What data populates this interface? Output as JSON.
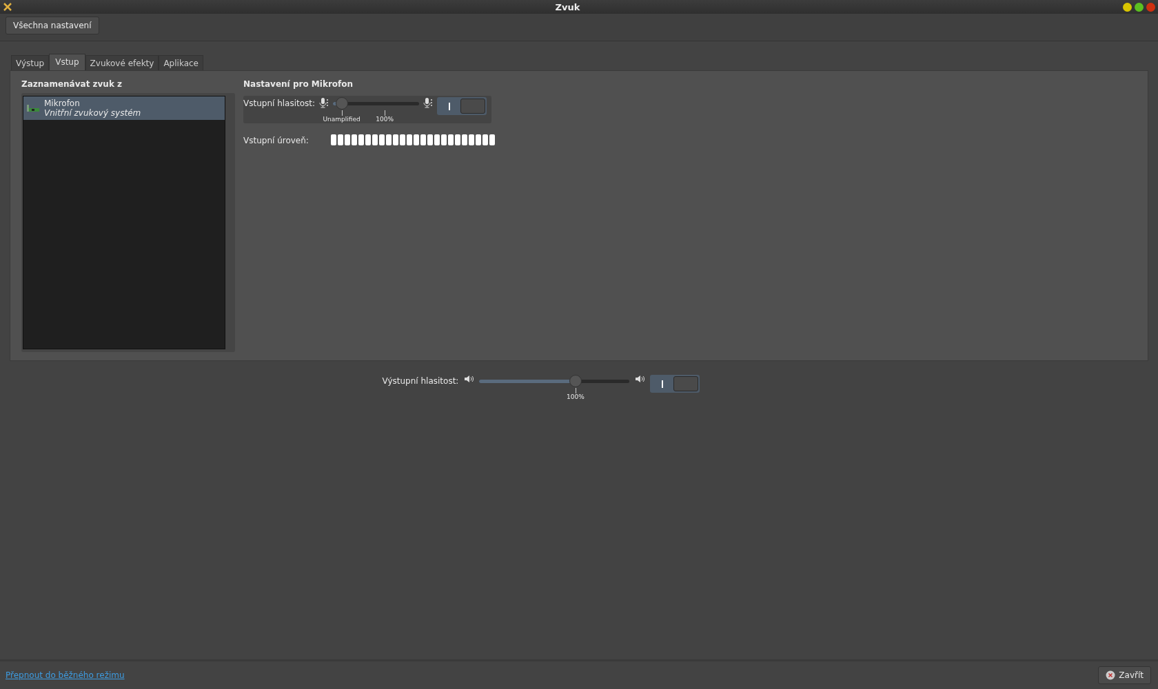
{
  "window": {
    "title": "Zvuk"
  },
  "toolbar": {
    "all_settings_button": "Všechna nastavení"
  },
  "tabs": [
    {
      "label": "Výstup",
      "selected": false
    },
    {
      "label": "Vstup",
      "selected": true
    },
    {
      "label": "Zvukové efekty",
      "selected": false
    },
    {
      "label": "Aplikace",
      "selected": false
    }
  ],
  "devices": {
    "heading": "Zaznamenávat zvuk z",
    "items": [
      {
        "name": "Mikrofon",
        "description": "Vnitřní zvukový systém",
        "selected": true
      }
    ]
  },
  "settings": {
    "heading": "Nastavení pro Mikrofon",
    "input_volume": {
      "label": "Vstupní hlasitost:",
      "level": 0.1,
      "marks": [
        {
          "label": "Unamplified"
        },
        {
          "label": "100%"
        }
      ],
      "on": true
    },
    "input_level": {
      "label": "Vstupní úroveň:"
    }
  },
  "output_volume": {
    "label": "Výstupní hlasitost:",
    "level": 0.64,
    "marks": [
      {
        "label": "100%"
      }
    ],
    "on": true
  },
  "footer": {
    "link": "Přepnout do běžného režimu",
    "close_button": "Zavřít"
  }
}
